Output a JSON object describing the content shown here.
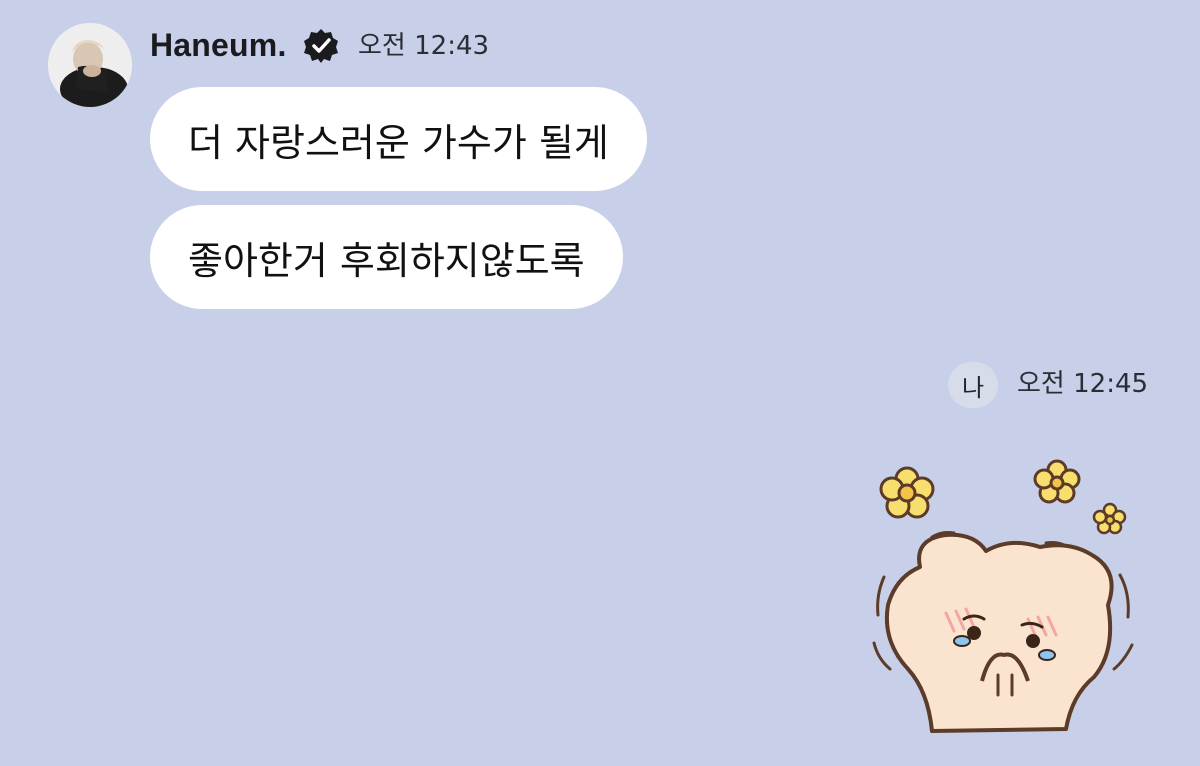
{
  "incoming": {
    "sender_name": "Haneum.",
    "verified_icon": "verified-check-badge-icon",
    "timestamp": "오전 12:43",
    "messages": [
      "더 자랑스러운 가수가 될게",
      "좋아한거 후회하지않도록"
    ]
  },
  "outgoing": {
    "me_label": "나",
    "timestamp": "오전 12:45",
    "sticker": "crying-bear-sticker"
  },
  "colors": {
    "background": "#c8d0e9",
    "bubble": "#ffffff",
    "text": "#111111"
  }
}
